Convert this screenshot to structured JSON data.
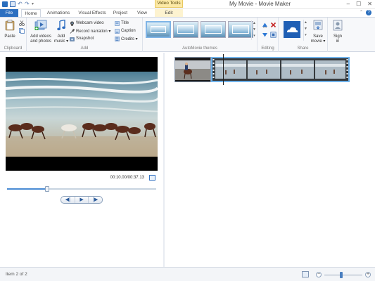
{
  "window": {
    "title": "My Movie - Movie Maker",
    "context_tab_group": "Video Tools",
    "controls": {
      "minimize": "–",
      "maximize": "☐",
      "close": "✕"
    }
  },
  "quick_access": {
    "undo": "↶",
    "redo": "↷",
    "dropdown": "▾"
  },
  "tabs": [
    {
      "label": "File"
    },
    {
      "label": "Home"
    },
    {
      "label": "Animations"
    },
    {
      "label": "Visual Effects"
    },
    {
      "label": "Project"
    },
    {
      "label": "View"
    },
    {
      "label": "Edit"
    }
  ],
  "help": {
    "label": "?",
    "collapse": "⌃"
  },
  "ribbon": {
    "clipboard": {
      "label": "Clipboard",
      "paste": "Paste"
    },
    "add": {
      "label": "Add",
      "add_videos_line1": "Add videos",
      "add_videos_line2": "and photos",
      "add_music_line1": "Add",
      "add_music_line2": "music ▾",
      "webcam": "Webcam video",
      "narration": "Record narration ▾",
      "snapshot": "Snapshot",
      "title": "Title",
      "caption": "Caption",
      "credits": "Credits ▾"
    },
    "themes": {
      "label": "AutoMovie themes",
      "scroll_up": "▲",
      "scroll_down": "▼",
      "scroll_more": "▾"
    },
    "editing": {
      "label": "Editing"
    },
    "share": {
      "label": "Share",
      "save_line1": "Save",
      "save_line2": "movie ▾"
    },
    "signin": {
      "line1": "Sign",
      "line2": "in"
    }
  },
  "preview": {
    "timecode": "00:10.00/00:37.13",
    "seek_position": 0.27,
    "transport": {
      "prev": "◀|",
      "play": "▶",
      "next": "|▶"
    }
  },
  "status": {
    "text": "Item 2 of 2",
    "zoom_minus": "−",
    "zoom_plus": "+",
    "zoom_level": 0.45
  },
  "colors": {
    "accent": "#2c6fc0",
    "context_tab": "#fce9a5",
    "selection_border": "#6fb2ea"
  }
}
